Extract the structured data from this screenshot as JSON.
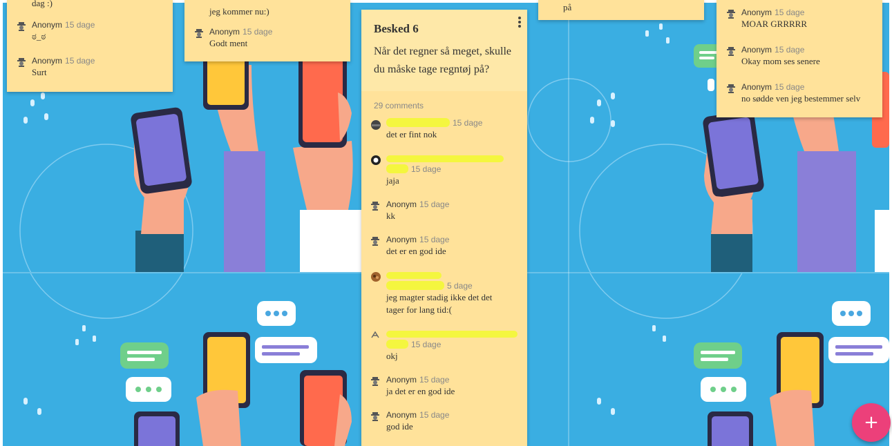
{
  "main_note": {
    "title": "Besked 6",
    "body": "Når det regner så meget, skulle du måske tage regntøj på?",
    "comment_count": "29 comments",
    "comments": [
      {
        "author": "",
        "time": "15 dage",
        "text": "det er fint nok",
        "avatar": "dark-avatar-icon",
        "redacted": true
      },
      {
        "author": "",
        "time": "15 dage",
        "text": "jaja",
        "avatar": "ring-avatar-icon",
        "redacted": true
      },
      {
        "author": "Anonym",
        "time": "15 dage",
        "text": "kk",
        "avatar": "anonymous-avatar-icon"
      },
      {
        "author": "Anonym",
        "time": "15 dage",
        "text": "det er en god ide",
        "avatar": "anonymous-avatar-icon"
      },
      {
        "author": "",
        "time": "5 dage",
        "text": "jeg magter stadig ikke det det tager for lang tid:(",
        "avatar": "photo-avatar-icon",
        "redacted": true
      },
      {
        "author": "",
        "time": "15 dage",
        "text": "okj",
        "avatar": "sketch-avatar-icon",
        "redacted": true
      },
      {
        "author": "Anonym",
        "time": "15 dage",
        "text": "ja det er en god ide",
        "avatar": "anonymous-avatar-icon"
      },
      {
        "author": "Anonym",
        "time": "15 dage",
        "text": "god ide",
        "avatar": "anonymous-avatar-icon"
      }
    ]
  },
  "note_left": {
    "top_text": "dag :)",
    "comments": [
      {
        "author": "Anonym",
        "time": "15 dage",
        "text": "ಠ_ಠ"
      },
      {
        "author": "Anonym",
        "time": "15 dage",
        "text": "Surt"
      }
    ]
  },
  "note_center_left": {
    "top_text": "jeg kommer nu:)",
    "comments": [
      {
        "author": "Anonym",
        "time": "15 dage",
        "text": "Godt ment"
      }
    ]
  },
  "note_center_right": {
    "top_text": "på"
  },
  "note_right": {
    "comments": [
      {
        "author": "Anonym",
        "time": "15 dage",
        "text": "MOAR GRRRRR"
      },
      {
        "author": "Anonym",
        "time": "15 dage",
        "text": "Okay mom ses senere"
      },
      {
        "author": "Anonym",
        "time": "15 dage",
        "text": "no sødde ven jeg bestemmer selv"
      }
    ]
  },
  "fab": {
    "label": "+",
    "color": "#ec407a"
  },
  "colors": {
    "note": "#ffe29a",
    "note_header": "#fee8a8",
    "wallpaper": "#3aaee2",
    "redaction": "#f4f63f"
  }
}
